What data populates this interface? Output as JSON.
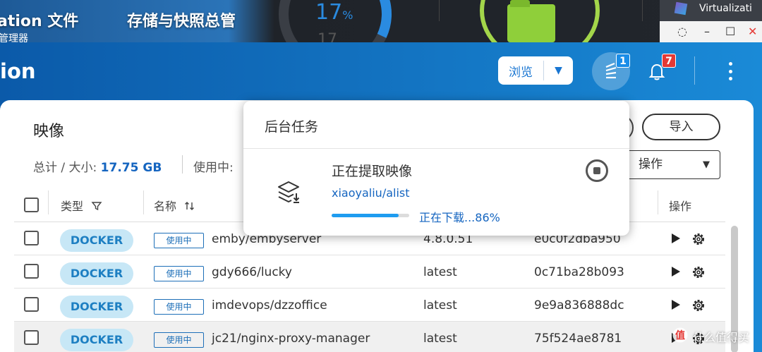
{
  "desktop": {
    "label_left": "ation 文件",
    "label_left_sub": "管理器",
    "label_mid": "存储与快照总管",
    "gauge_value": "17",
    "gauge_unit": "%",
    "gauge_ghost": "17",
    "vm_window_title": "Virtualizati",
    "win_controls": [
      "◌",
      "–",
      "☐",
      "✕"
    ]
  },
  "app": {
    "title": "ion",
    "browse_label": "浏览",
    "tasks_badge": "1",
    "notifications_badge": "7"
  },
  "panel": {
    "title": "映像",
    "summary_prefix": "总计 / 大小: ",
    "summary_value": "17.75 GB",
    "inuse_label": "使用中:",
    "import_label": "导入",
    "action_label": "操作"
  },
  "table": {
    "headers": {
      "type": "类型",
      "name": "名称",
      "action": "操作"
    },
    "rows": [
      {
        "type": "DOCKER",
        "status": "使用中",
        "name": "emby/embyserver",
        "tag": "4.8.0.51",
        "id": "e0c0f2dba950"
      },
      {
        "type": "DOCKER",
        "status": "使用中",
        "name": "gdy666/lucky",
        "tag": "latest",
        "id": "0c71ba28b093"
      },
      {
        "type": "DOCKER",
        "status": "使用中",
        "name": "imdevops/dzzoffice",
        "tag": "latest",
        "id": "9e9a836888dc"
      },
      {
        "type": "DOCKER",
        "status": "使用中",
        "name": "jc21/nginx-proxy-manager",
        "tag": "latest",
        "id": "75f524ae8781"
      }
    ]
  },
  "popup": {
    "title": "后台任务",
    "task_title": "正在提取映像",
    "task_subject": "xiaoyaliu/alist",
    "task_status": "正在下载...86%",
    "progress": 0.86
  },
  "watermark": {
    "text": "什么值得买"
  }
}
